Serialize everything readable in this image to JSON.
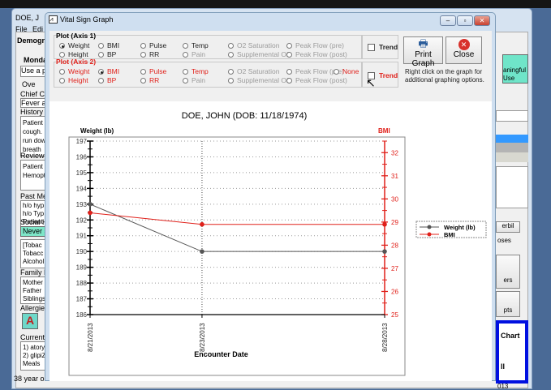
{
  "background_window": {
    "title": "DOE, J",
    "menu": [
      "File",
      "Edi"
    ],
    "tab": "Demogra",
    "fields": [
      "Monda",
      "Use a p",
      "Ove",
      "Chief Co",
      "Fever a",
      "History",
      "Patient",
      "cough.",
      "run dow",
      "breath",
      "Review",
      "Patient",
      "Hemopt",
      "Past Me",
      "h/o hyp",
      "h/o Typ",
      "Patient",
      "Social H",
      "Never s",
      "[Tobac",
      "Tobacc",
      "Alcohol",
      "Family H",
      "Mother",
      "Father",
      "Siblings",
      "Allergies",
      "Current",
      "1) atory",
      "2) glipiZ",
      "Meals"
    ],
    "status": "38 year ol",
    "right_labels": [
      "aningful Use",
      "erbil",
      "oses",
      "ers",
      "pts",
      "Chart",
      "ll",
      "013"
    ]
  },
  "dialog": {
    "title": "Vital Sign Graph",
    "axis1": {
      "label": "Plot (Axis 1)",
      "options": [
        "Weight",
        "BMI",
        "Pulse",
        "Temp",
        "O2 Saturation",
        "Peak Flow (pre)",
        "Height",
        "BP",
        "RR",
        "Pain",
        "Supplemental O2",
        "Peak Flow (post)"
      ],
      "selected": "Weight",
      "trend_label": "Trend",
      "trend_checked": false
    },
    "axis2": {
      "label": "Plot (Axis 2)",
      "options": [
        "Weight",
        "BMI",
        "Pulse",
        "Temp",
        "O2 Saturation",
        "Peak Flow (pre)",
        "None",
        "Height",
        "BP",
        "RR",
        "Pain",
        "Supplemental O2",
        "Peak Flow (post)"
      ],
      "selected": "BMI",
      "trend_label": "Trend",
      "trend_checked": false
    },
    "print_label": "Print Graph",
    "close_label": "Close",
    "hint": "Right click on the graph for additional graphing options.",
    "colors": {
      "axis1": "#555555",
      "axis2": "#e0201a"
    }
  },
  "chart_data": {
    "type": "line",
    "title": "DOE, JOHN  (DOB: 11/18/1974)",
    "xlabel": "Encounter Date",
    "categories": [
      "8/21/2013",
      "8/23/2013",
      "8/28/2013"
    ],
    "y1label": "Weight (lb)",
    "y1lim": [
      186,
      197
    ],
    "y1ticks": [
      186,
      187,
      188,
      189,
      190,
      191,
      192,
      193,
      194,
      195,
      196,
      197
    ],
    "y2label": "BMI",
    "y2lim": [
      25,
      32.5
    ],
    "y2ticks": [
      25,
      26,
      27,
      28,
      29,
      30,
      31,
      32
    ],
    "grid": true,
    "legend": "right",
    "series": [
      {
        "name": "Weight (lb)",
        "axis": 1,
        "color": "#555555",
        "values": [
          193,
          190,
          190
        ]
      },
      {
        "name": "BMI",
        "axis": 2,
        "color": "#e0201a",
        "values": [
          29.4,
          28.9,
          28.9
        ]
      }
    ]
  }
}
